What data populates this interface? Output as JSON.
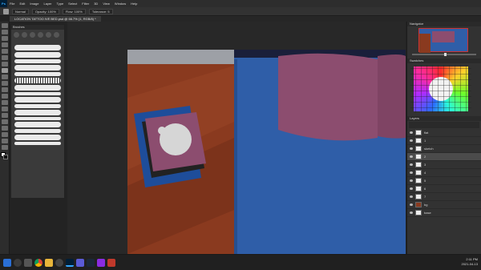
{
  "app": {
    "logo": "Ps"
  },
  "menu": [
    "File",
    "Edit",
    "Image",
    "Layer",
    "Type",
    "Select",
    "Filter",
    "3D",
    "View",
    "Window",
    "Help"
  ],
  "options": {
    "mode": "Normal",
    "opacity_label": "Opacity: 100%",
    "flow_label": "Flow: 100%",
    "tolerance": "Tolerance: 5"
  },
  "document": {
    "tab": "LOCATION TATTOO IVE BED.psd @ 66.7% (1, RGB/8) *"
  },
  "brushes": {
    "title": "Brushes"
  },
  "panels": {
    "navigator": "Navigator",
    "swatches": "Swatches",
    "layers": "Layers"
  },
  "layers": [
    {
      "name": "flat"
    },
    {
      "name": "1"
    },
    {
      "name": "sketch"
    },
    {
      "name": "2"
    },
    {
      "name": "3"
    },
    {
      "name": "4"
    },
    {
      "name": "5"
    },
    {
      "name": "6"
    },
    {
      "name": "7"
    },
    {
      "name": "bg"
    },
    {
      "name": "base"
    }
  ],
  "taskbar": {
    "time": "2:11 PM",
    "date": "2021-04-13"
  },
  "colors": {
    "accent": "#31a8ff",
    "blue_bed": "#2f5ea8",
    "pink": "#8c4d6f",
    "wood": "#8a3a1f"
  }
}
